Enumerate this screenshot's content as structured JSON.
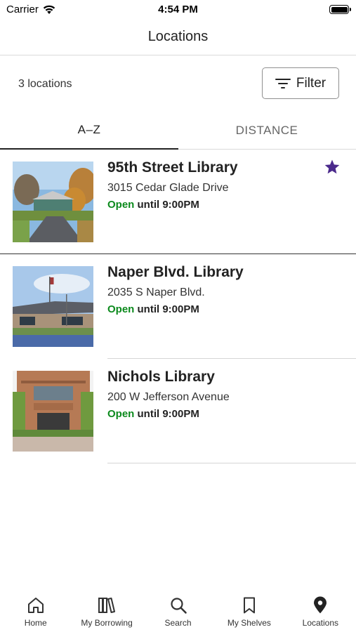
{
  "status_bar": {
    "carrier": "Carrier",
    "time": "4:54 PM"
  },
  "header": {
    "title": "Locations"
  },
  "toolbar": {
    "count_label": "3 locations",
    "filter_label": "Filter"
  },
  "tabs": [
    {
      "label": "A–Z",
      "selected": true
    },
    {
      "label": "DISTANCE",
      "selected": false
    }
  ],
  "locations": [
    {
      "name": "95th Street Library",
      "address": "3015 Cedar Glade Drive",
      "status": "Open",
      "hours": "until 9:00PM",
      "favorite": true
    },
    {
      "name": "Naper Blvd. Library",
      "address": "2035 S Naper Blvd.",
      "status": "Open",
      "hours": "until 9:00PM",
      "favorite": false
    },
    {
      "name": "Nichols Library",
      "address": "200 W Jefferson Avenue",
      "status": "Open",
      "hours": "until 9:00PM",
      "favorite": false
    }
  ],
  "bottom_nav": [
    {
      "label": "Home",
      "icon": "home-icon"
    },
    {
      "label": "My Borrowing",
      "icon": "books-icon"
    },
    {
      "label": "Search",
      "icon": "search-icon"
    },
    {
      "label": "My Shelves",
      "icon": "bookmark-icon"
    },
    {
      "label": "Locations",
      "icon": "location-pin-icon"
    }
  ],
  "colors": {
    "open_status": "#0c8a1d",
    "favorite_star": "#4b2a8c",
    "text_primary": "#222222"
  }
}
